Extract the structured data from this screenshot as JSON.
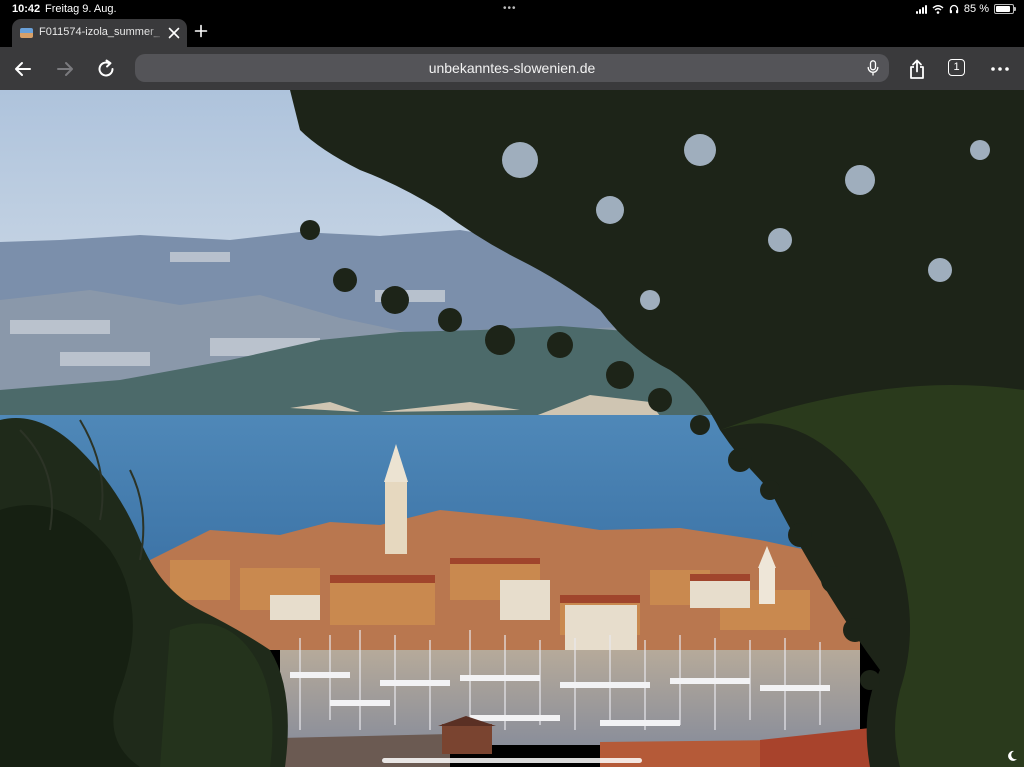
{
  "status_bar": {
    "time": "10:42",
    "date": "Freitag 9. Aug.",
    "battery_percent": "85 %",
    "battery_level": 0.85,
    "dots": "•••"
  },
  "tab": {
    "title": "F011574-izola_summer_"
  },
  "toolbar": {
    "url": "unbekanntes-slowenien.de",
    "tabs_count": "1"
  },
  "icons": {
    "back": "arrow-left-icon",
    "forward": "arrow-right-icon",
    "reload": "reload-icon",
    "microphone": "microphone-icon",
    "share": "share-icon",
    "tabs": "tabs-icon",
    "more": "more-icon",
    "close": "close-icon",
    "new_tab": "plus-icon"
  },
  "colors": {
    "chrome_bg": "#000000",
    "toolbar_bg": "#3a3a3c",
    "urlbar_bg": "#545458",
    "sea": "#3f7bb0",
    "sky": "#b9cbe0"
  }
}
